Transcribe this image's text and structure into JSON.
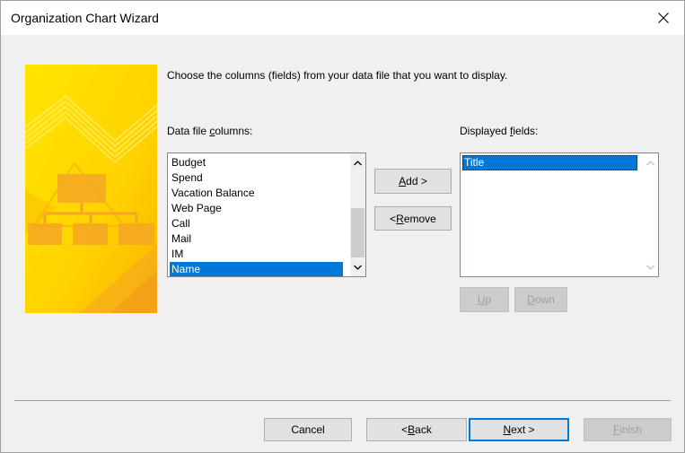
{
  "window": {
    "title": "Organization Chart Wizard"
  },
  "instruction": "Choose the columns (fields) from your data file that you want to display.",
  "data_columns": {
    "label_pre": "Data file ",
    "label_hot": "c",
    "label_post": "olumns:",
    "items": [
      "Budget",
      "Spend",
      "Vacation Balance",
      "Web Page",
      "Call",
      "Mail",
      "IM",
      "Name"
    ],
    "selected": "Name"
  },
  "displayed_fields": {
    "label_pre": "Displayed ",
    "label_hot": "f",
    "label_post": "ields:",
    "items": [
      "Title"
    ],
    "selected": "Title"
  },
  "buttons": {
    "add_hot": "A",
    "add_rest": "dd >",
    "remove_pre": "< ",
    "remove_hot": "R",
    "remove_rest": "emove",
    "up_hot": "U",
    "up_rest": "p",
    "down_hot": "D",
    "down_rest": "own",
    "cancel": "Cancel",
    "back_pre": "< ",
    "back_hot": "B",
    "back_rest": "ack",
    "next_hot": "N",
    "next_rest": "ext >",
    "finish_hot": "F",
    "finish_rest": "inish"
  },
  "colors": {
    "selection": "#0078d7",
    "banner_yellow": "#ffd400",
    "banner_orange": "#f5a623"
  },
  "icons": {
    "close": "close-icon",
    "scroll_up": "chevron-up-icon",
    "scroll_down": "chevron-down-icon"
  }
}
